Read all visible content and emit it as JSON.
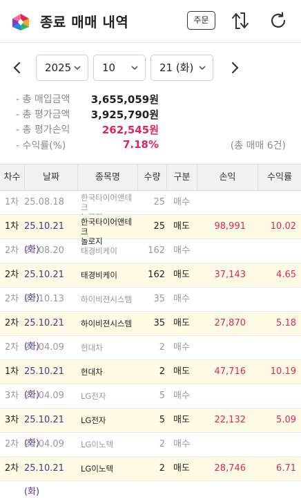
{
  "header": {
    "title": "종료 매매 내역",
    "order_label": "주문"
  },
  "date": {
    "year": "2025",
    "month": "10",
    "day": "21 (화)"
  },
  "summary": {
    "buy_label": "- 총 매입금액",
    "buy_value": "3,655,059원",
    "eval_label": "- 총 평가금액",
    "eval_value": "3,925,790원",
    "pnl_label": "- 총 평가손익",
    "pnl_value": "262,545원",
    "rate_label": "- 수익률(%)",
    "rate_value": "7.18%",
    "total_trades": "(총 매매 6건)"
  },
  "colors": {
    "profit": "#e0245e",
    "sell_row_bg": "#fdfbe3",
    "header_bg": "#f1f1f1"
  },
  "table": {
    "columns": [
      "차수",
      "날짜",
      "종목명",
      "수량",
      "구분",
      "손익",
      "수익률"
    ],
    "rows": [
      {
        "round": "1차",
        "date": "25.08.18",
        "name": "한국타이어앤테크놀로지",
        "qty": "25",
        "type": "매수",
        "pnl": "",
        "rate": ""
      },
      {
        "round": "1차",
        "date": "25.10.21 (화)",
        "name": "한국타이어앤테크놀로지",
        "qty": "25",
        "type": "매도",
        "pnl": "98,991",
        "rate": "10.02"
      },
      {
        "round": "2차",
        "date": "25.08.20",
        "name": "태경비케이",
        "qty": "162",
        "type": "매수",
        "pnl": "",
        "rate": ""
      },
      {
        "round": "2차",
        "date": "25.10.21 (화)",
        "name": "태경비케이",
        "qty": "162",
        "type": "매도",
        "pnl": "37,143",
        "rate": "4.65"
      },
      {
        "round": "2차",
        "date": "25.10.13",
        "name": "하이비젼시스템",
        "qty": "35",
        "type": "매수",
        "pnl": "",
        "rate": ""
      },
      {
        "round": "2차",
        "date": "25.10.21 (화)",
        "name": "하이비젼시스템",
        "qty": "35",
        "type": "매도",
        "pnl": "27,870",
        "rate": "5.18"
      },
      {
        "round": "2차",
        "date": "25.04.09",
        "name": "현대차",
        "qty": "2",
        "type": "매수",
        "pnl": "",
        "rate": ""
      },
      {
        "round": "1차",
        "date": "25.10.21 (화)",
        "name": "현대차",
        "qty": "2",
        "type": "매도",
        "pnl": "47,716",
        "rate": "10.19"
      },
      {
        "round": "3차",
        "date": "25.04.09",
        "name": "LG전자",
        "qty": "5",
        "type": "매수",
        "pnl": "",
        "rate": ""
      },
      {
        "round": "3차",
        "date": "25.10.21 (화)",
        "name": "LG전자",
        "qty": "5",
        "type": "매도",
        "pnl": "22,132",
        "rate": "5.09"
      },
      {
        "round": "2차",
        "date": "25.04.09",
        "name": "LG이노텍",
        "qty": "2",
        "type": "매수",
        "pnl": "",
        "rate": ""
      },
      {
        "round": "2차",
        "date": "25.10.21 (화)",
        "name": "LG이노텍",
        "qty": "2",
        "type": "매도",
        "pnl": "28,746",
        "rate": "6.71"
      }
    ]
  }
}
